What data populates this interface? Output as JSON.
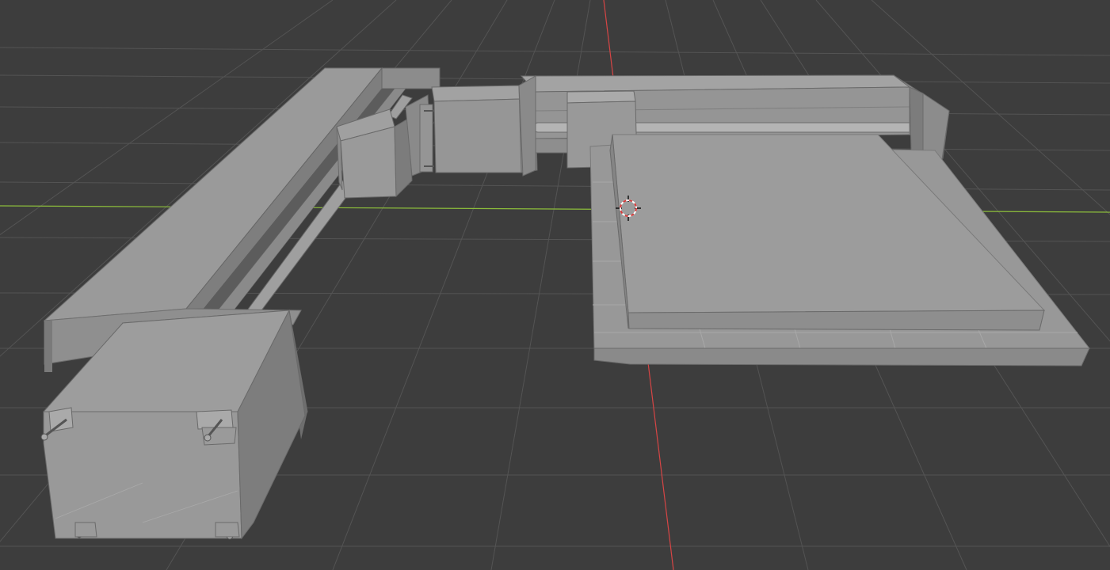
{
  "viewport": {
    "background": "#3d3d3d",
    "grid_color": "#545454",
    "axis_x_color": "#8cbd3b",
    "axis_y_color": "#d64545",
    "mesh_color": "#8e8e8e",
    "cursor_colors": [
      "#d63a3a",
      "#ffffff",
      "#111111"
    ]
  },
  "icons": {
    "cursor": "3d-cursor-icon"
  }
}
